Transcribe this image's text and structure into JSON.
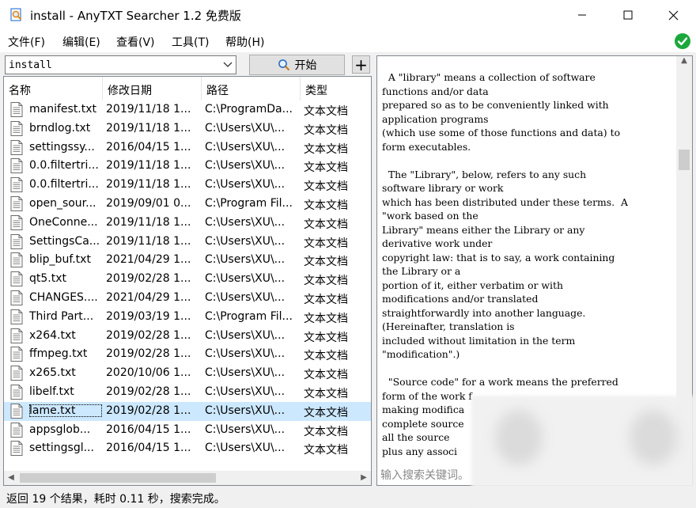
{
  "window": {
    "title": "install - AnyTXT Searcher 1.2 免费版",
    "icon": "magnifier-document-icon",
    "controls": [
      "minimize-icon",
      "maximize-icon",
      "close-icon"
    ]
  },
  "menu": {
    "items": [
      "文件(F)",
      "编辑(E)",
      "查看(V)",
      "工具(T)",
      "帮助(H)"
    ],
    "status_icon": "checkmark-circle-icon",
    "status_color": "#1aa83c"
  },
  "search": {
    "value": "install",
    "start_label": "开始",
    "start_icon": "search-icon",
    "add_label": "+"
  },
  "results": {
    "columns": [
      "名称",
      "修改日期",
      "路径",
      "类型"
    ],
    "selected_index": 16,
    "rows": [
      {
        "name": "manifest.txt",
        "date": "2019/11/18  1...",
        "path": "C:\\ProgramDa...",
        "type": "文本文档"
      },
      {
        "name": "brndlog.txt",
        "date": "2019/11/18  1...",
        "path": "C:\\Users\\XU\\...",
        "type": "文本文档"
      },
      {
        "name": "settingssy...",
        "date": "2016/04/15  1...",
        "path": "C:\\Users\\XU\\...",
        "type": "文本文档"
      },
      {
        "name": "0.0.filtertri...",
        "date": "2019/11/18  1...",
        "path": "C:\\Users\\XU\\...",
        "type": "文本文档"
      },
      {
        "name": "0.0.filtertri...",
        "date": "2019/11/18  1...",
        "path": "C:\\Users\\XU\\...",
        "type": "文本文档"
      },
      {
        "name": "open_sour...",
        "date": "2019/09/01  0...",
        "path": "C:\\Program Fil...",
        "type": "文本文档"
      },
      {
        "name": "OneConne...",
        "date": "2019/11/18  1...",
        "path": "C:\\Users\\XU\\...",
        "type": "文本文档"
      },
      {
        "name": "SettingsCa...",
        "date": "2019/11/18  1...",
        "path": "C:\\Users\\XU\\...",
        "type": "文本文档"
      },
      {
        "name": "blip_buf.txt",
        "date": "2021/04/29  1...",
        "path": "C:\\Users\\XU\\...",
        "type": "文本文档"
      },
      {
        "name": "qt5.txt",
        "date": "2019/02/28  1...",
        "path": "C:\\Users\\XU\\...",
        "type": "文本文档"
      },
      {
        "name": "CHANGES....",
        "date": "2021/04/29  1...",
        "path": "C:\\Users\\XU\\...",
        "type": "文本文档"
      },
      {
        "name": "Third Part...",
        "date": "2019/03/19  1...",
        "path": "C:\\Program Fil...",
        "type": "文本文档"
      },
      {
        "name": "x264.txt",
        "date": "2019/02/28  1...",
        "path": "C:\\Users\\XU\\...",
        "type": "文本文档"
      },
      {
        "name": "ffmpeg.txt",
        "date": "2019/02/28  1...",
        "path": "C:\\Users\\XU\\...",
        "type": "文本文档"
      },
      {
        "name": "x265.txt",
        "date": "2020/10/06  1...",
        "path": "C:\\Users\\XU\\...",
        "type": "文本文档"
      },
      {
        "name": "libelf.txt",
        "date": "2019/02/28  1...",
        "path": "C:\\Users\\XU\\...",
        "type": "文本文档"
      },
      {
        "name": "lame.txt",
        "date": "2019/02/28  1...",
        "path": "C:\\Users\\XU\\...",
        "type": "文本文档"
      },
      {
        "name": "appsglob...",
        "date": "2016/04/15  1...",
        "path": "C:\\Users\\XU\\...",
        "type": "文本文档"
      },
      {
        "name": "settingsgl...",
        "date": "2016/04/15  1...",
        "path": "C:\\Users\\XU\\...",
        "type": "文本文档"
      }
    ]
  },
  "preview": {
    "text": "  A \"library\" means a collection of software\nfunctions and/or data\nprepared so as to be conveniently linked with\napplication programs\n(which use some of those functions and data) to\nform executables.\n\n  The \"Library\", below, refers to any such\nsoftware library or work\nwhich has been distributed under these terms.  A\n\"work based on the\nLibrary\" means either the Library or any\nderivative work under\ncopyright law: that is to say, a work containing\nthe Library or a\nportion of it, either verbatim or with\nmodifications and/or translated\nstraightforwardly into another language.\n(Hereinafter, translation is\nincluded without limitation in the term\n\"modification\".)\n\n  \"Source code\" for a work means the preferred\nform of the work f\nmaking modifica\ncomplete source\nall the source\nplus any associ",
    "find_placeholder": "输入搜索关键词。"
  },
  "status": {
    "text": "返回 19 个结果，耗时 0.11 秒，搜索完成。"
  }
}
